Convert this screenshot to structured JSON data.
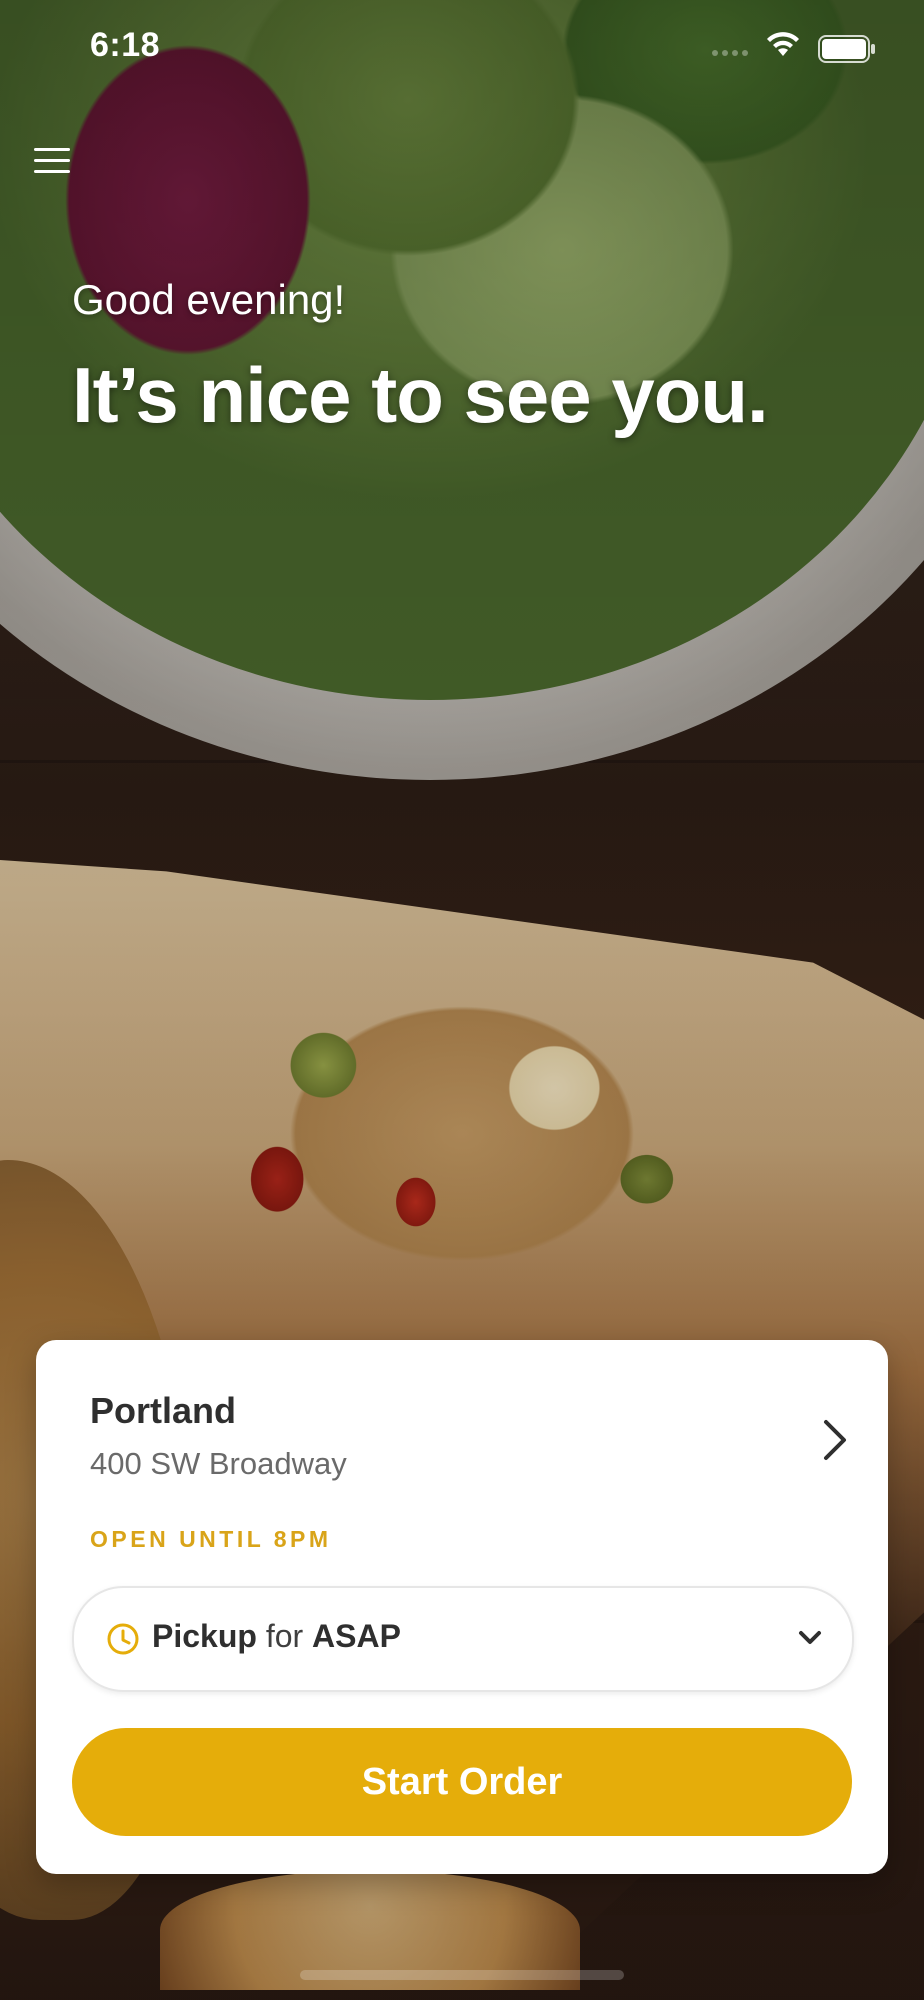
{
  "status_bar": {
    "time": "6:18"
  },
  "header": {
    "menu_icon": "hamburger-menu-icon",
    "greeting": "Good evening!",
    "headline": "It’s nice to see you."
  },
  "location": {
    "name": "Portland",
    "address": "400 SW Broadway",
    "status": "OPEN UNTIL 8PM",
    "chevron_icon": "chevron-right-icon"
  },
  "pickup": {
    "icon": "clock-icon",
    "mode": "Pickup",
    "connector": "for",
    "time": "ASAP",
    "dropdown_icon": "chevron-down-icon"
  },
  "actions": {
    "start_order": "Start Order"
  },
  "colors": {
    "accent": "#E5AD0A",
    "open_status": "#D9A419",
    "card_bg": "#FFFFFF",
    "text_dark": "#2F2F2F",
    "text_muted": "#6A6A6A"
  }
}
